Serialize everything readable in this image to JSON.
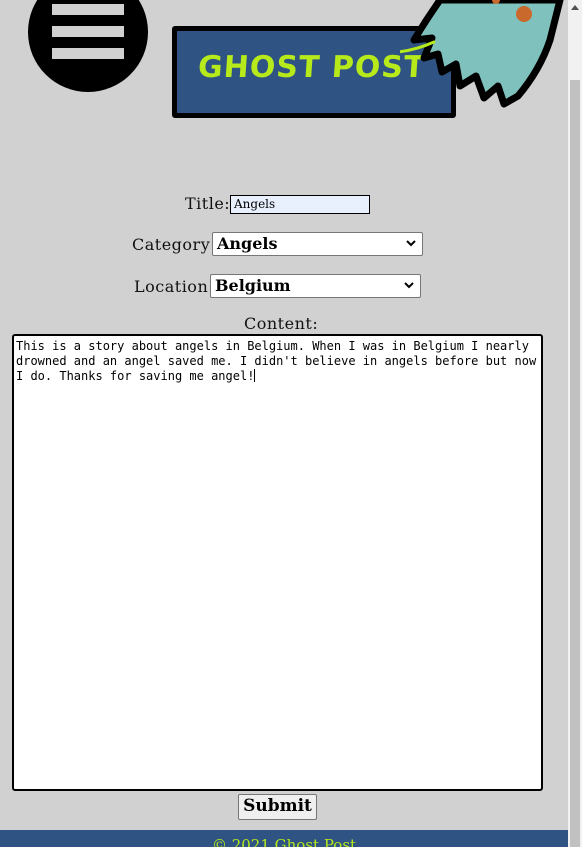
{
  "header": {
    "menu_icon": "hamburger-menu-icon",
    "logo_text": "GHOST POST",
    "logo_image": "ghost-icon"
  },
  "form": {
    "title_label": "Title:",
    "title_value": "Angels",
    "category_label": "Category:",
    "category_value": "Angels",
    "location_label": "Location:",
    "location_value": "Belgium",
    "content_label": "Content:",
    "content_value": "This is a story about angels in Belgium. When I was in Belgium I nearly drowned and an angel saved me. I didn't believe in angels before but now I do. Thanks for saving me angel!",
    "submit_label": "Submit"
  },
  "footer": {
    "text": "© 2021 Ghost Post"
  },
  "colors": {
    "background": "#d1d1d1",
    "brand_blue": "#2f5382",
    "brand_green": "#b6ea1b",
    "ghost_teal": "#7fc2bd"
  }
}
